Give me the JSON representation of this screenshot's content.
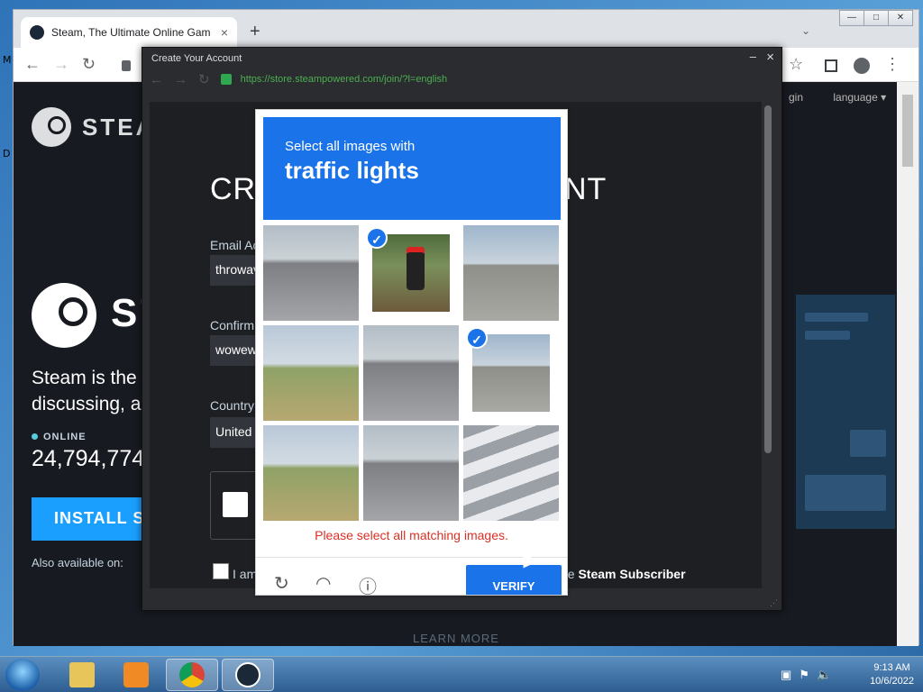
{
  "desktop": {
    "frag1": "M",
    "frag2": "D"
  },
  "browser": {
    "tab_title": "Steam, The Ultimate Online Gam",
    "tab_close": "×",
    "new_tab": "+",
    "win_min": "—",
    "win_max": "□",
    "win_close": "✕",
    "tab_dropdown": "⌄",
    "back": "←",
    "forward": "→",
    "reload": "↻",
    "star": "☆",
    "menu": "⋮"
  },
  "steam": {
    "logo_text": "STEAM",
    "big_text": "ST",
    "promo_line1": "Steam is the u",
    "promo_line2": "discussing, ar",
    "online_label": "ONLINE",
    "online_count": "24,794,774",
    "install_button": "INSTALL ST",
    "also_available": "Also available on:",
    "learn_more": "LEARN MORE",
    "login": "gin",
    "language": "language ▾"
  },
  "popup": {
    "title": "Create Your Account",
    "minimize": "–",
    "close": "×",
    "url": "https://store.steampowered.com/join/?l=english",
    "heading_left": "CRE",
    "heading_right": "NT",
    "email_label": "Email Ac",
    "email_value": "throwav",
    "confirm_label": "Confirm",
    "confirm_value": "wowew",
    "country_label": "Country",
    "country_value": "United",
    "agree_text": "I am",
    "subscriber_prefix": "ne",
    "subscriber_bold": "Steam Subscriber"
  },
  "captcha": {
    "instruction": "Select all images with",
    "target": "traffic lights",
    "error": "Please select all matching images.",
    "verify": "VERIFY",
    "checkmark": "✓",
    "tiles": [
      {
        "scene": "motorcycle on road",
        "selected": false
      },
      {
        "scene": "traffic light",
        "selected": true
      },
      {
        "scene": "intersection buildings",
        "selected": false
      },
      {
        "scene": "field road",
        "selected": false
      },
      {
        "scene": "road intersection",
        "selected": false
      },
      {
        "scene": "traffic light",
        "selected": true
      },
      {
        "scene": "hill road",
        "selected": false
      },
      {
        "scene": "highway",
        "selected": false
      },
      {
        "scene": "crosswalk car",
        "selected": false
      }
    ]
  },
  "taskbar": {
    "time": "9:13 AM",
    "date": "10/6/2022"
  }
}
